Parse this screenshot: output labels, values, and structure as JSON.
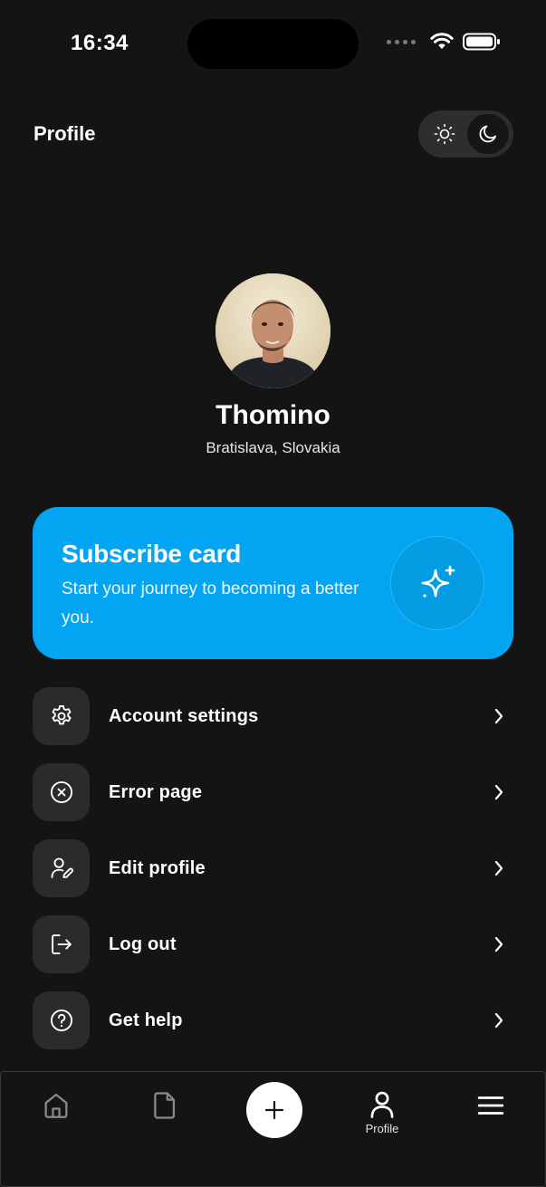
{
  "status_bar": {
    "time": "16:34"
  },
  "header": {
    "title": "Profile"
  },
  "profile": {
    "name": "Thomino",
    "location": "Bratislava, Slovakia"
  },
  "subscribe_card": {
    "title": "Subscribe card",
    "description": "Start your journey to becoming a better you.",
    "background": "#03a5f2"
  },
  "menu": {
    "items": [
      {
        "label": "Account settings",
        "icon": "gear-icon"
      },
      {
        "label": "Error page",
        "icon": "x-circle-icon"
      },
      {
        "label": "Edit profile",
        "icon": "user-edit-icon"
      },
      {
        "label": "Log out",
        "icon": "logout-icon"
      },
      {
        "label": "Get help",
        "icon": "help-circle-icon"
      }
    ]
  },
  "tab_bar": {
    "tabs": [
      {
        "icon": "home-icon"
      },
      {
        "icon": "document-icon"
      },
      {
        "icon": "plus-icon"
      },
      {
        "icon": "user-icon",
        "label": "Profile",
        "active": true
      },
      {
        "icon": "menu-icon"
      }
    ]
  },
  "colors": {
    "background": "#141414",
    "accent": "#03a5f2",
    "surface": "#2b2b2b"
  }
}
